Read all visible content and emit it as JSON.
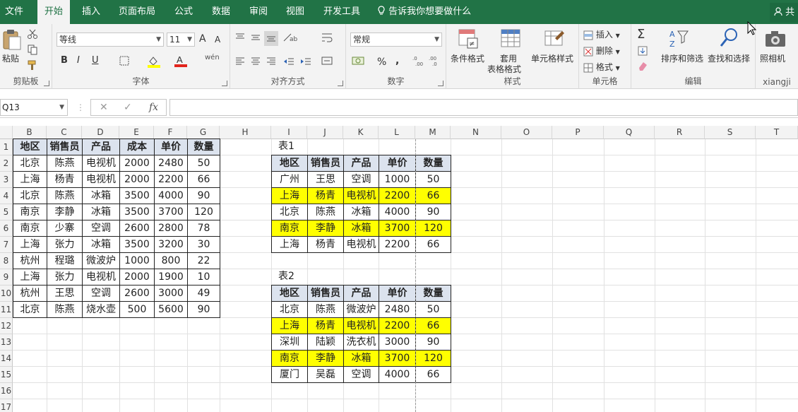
{
  "tabs": [
    "文件",
    "开始",
    "插入",
    "页面布局",
    "公式",
    "数据",
    "审阅",
    "视图",
    "开发工具"
  ],
  "tell_me": "告诉我你想要做什么",
  "share_label": "共",
  "ribbon": {
    "clipboard": {
      "paste": "粘贴",
      "label": "剪贴板"
    },
    "font": {
      "name": "等线",
      "size": "11",
      "bold": "B",
      "italic": "I",
      "underline": "U",
      "label": "字体",
      "inc": "A",
      "dec": "A",
      "wen": "wén"
    },
    "align": {
      "label": "对齐方式"
    },
    "number": {
      "format": "常规",
      "label": "数字",
      "percent": "%",
      "comma": ","
    },
    "styles": {
      "cond": "条件格式",
      "table1": "套用",
      "table2": "表格格式",
      "cell": "单元格样式",
      "label": "样式"
    },
    "cells": {
      "insert": "插入",
      "delete": "删除",
      "format": "格式",
      "label": "单元格"
    },
    "edit": {
      "sort": "排序和筛选",
      "find": "查找和选择",
      "label": "编辑"
    },
    "camera": {
      "btn": "照相机",
      "label": "xiangji"
    }
  },
  "formula_bar": {
    "name_box": "Q13",
    "fx": "fx",
    "cancel": "✕",
    "enter": "✓",
    "value": ""
  },
  "columns": [
    "B",
    "C",
    "D",
    "E",
    "F",
    "G",
    "H",
    "I",
    "J",
    "K",
    "L",
    "M",
    "N",
    "O",
    "P",
    "Q",
    "R",
    "S",
    "T"
  ],
  "rows": [
    "1",
    "2",
    "3",
    "4",
    "5",
    "6",
    "7",
    "8",
    "9",
    "10",
    "11",
    "12",
    "13",
    "14",
    "15",
    "16",
    "17"
  ],
  "main_table": {
    "headers": [
      "地区",
      "销售员",
      "产品",
      "成本",
      "单价",
      "数量"
    ],
    "rows": [
      [
        "北京",
        "陈燕",
        "电视机",
        "2000",
        "2480",
        "50"
      ],
      [
        "上海",
        "杨青",
        "电视机",
        "2000",
        "2200",
        "66"
      ],
      [
        "北京",
        "陈燕",
        "冰箱",
        "3500",
        "4000",
        "90"
      ],
      [
        "南京",
        "李静",
        "冰箱",
        "3500",
        "3700",
        "120"
      ],
      [
        "南京",
        "少寨",
        "空调",
        "2600",
        "2800",
        "78"
      ],
      [
        "上海",
        "张力",
        "冰箱",
        "3500",
        "3200",
        "30"
      ],
      [
        "杭州",
        "程璐",
        "微波炉",
        "1000",
        "800",
        "22"
      ],
      [
        "上海",
        "张力",
        "电视机",
        "2000",
        "1900",
        "10"
      ],
      [
        "杭州",
        "王思",
        "空调",
        "2600",
        "3000",
        "49"
      ],
      [
        "北京",
        "陈燕",
        "烧水壶",
        "500",
        "5600",
        "90"
      ]
    ]
  },
  "table1": {
    "title": "表1",
    "headers": [
      "地区",
      "销售员",
      "产品",
      "单价",
      "数量"
    ],
    "rows": [
      [
        "广州",
        "王思",
        "空调",
        "1000",
        "50"
      ],
      [
        "上海",
        "杨青",
        "电视机",
        "2200",
        "66"
      ],
      [
        "北京",
        "陈燕",
        "冰箱",
        "4000",
        "90"
      ],
      [
        "南京",
        "李静",
        "冰箱",
        "3700",
        "120"
      ],
      [
        "上海",
        "杨青",
        "电视机",
        "2200",
        "66"
      ]
    ],
    "highlight": [
      false,
      true,
      false,
      true,
      false
    ]
  },
  "table2": {
    "title": "表2",
    "headers": [
      "地区",
      "销售员",
      "产品",
      "单价",
      "数量"
    ],
    "rows": [
      [
        "北京",
        "陈燕",
        "微波炉",
        "2480",
        "50"
      ],
      [
        "上海",
        "杨青",
        "电视机",
        "2200",
        "66"
      ],
      [
        "深圳",
        "陆颖",
        "洗衣机",
        "3000",
        "90"
      ],
      [
        "南京",
        "李静",
        "冰箱",
        "3700",
        "120"
      ],
      [
        "厦门",
        "吴磊",
        "空调",
        "4000",
        "66"
      ]
    ],
    "highlight": [
      false,
      true,
      false,
      true,
      false
    ]
  },
  "colors": {
    "ribbon_green": "#217346",
    "highlight": "#ffff00",
    "header_fill": "#dce3ee"
  }
}
